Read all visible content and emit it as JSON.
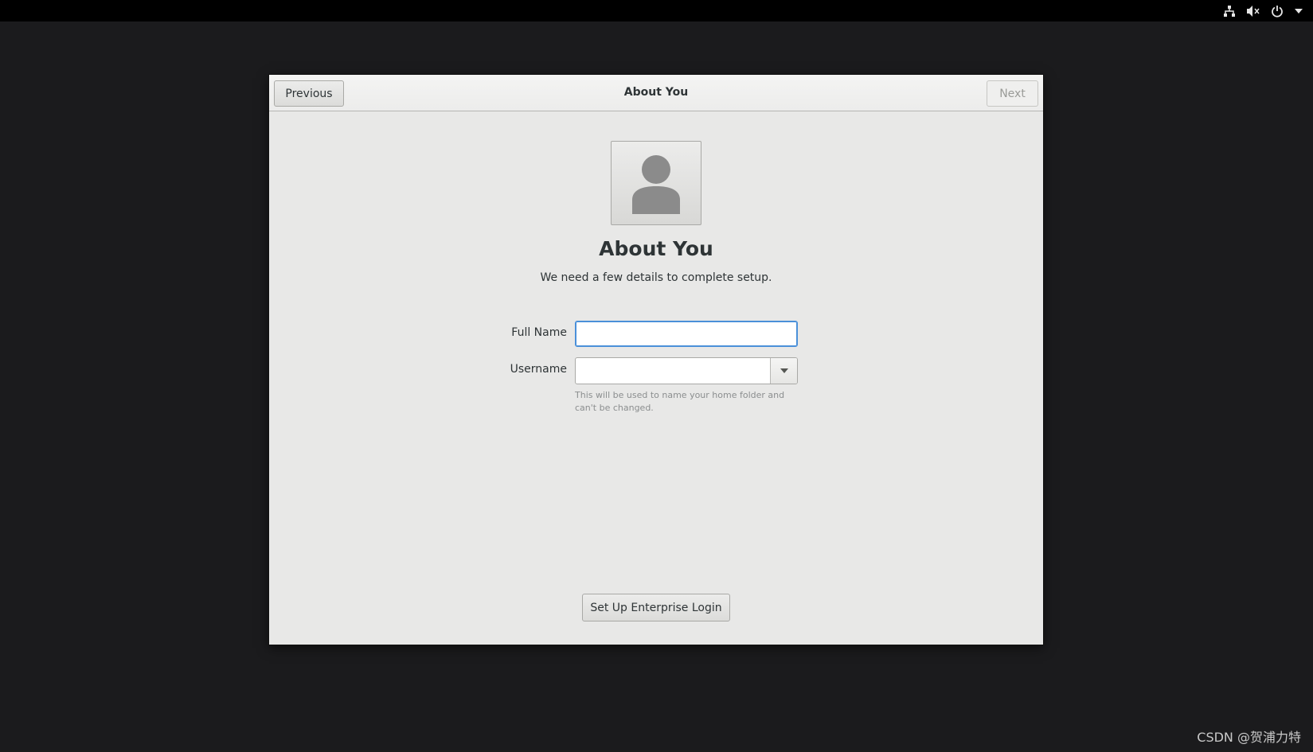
{
  "topbar": {
    "icons": [
      "network-icon",
      "volume-muted-icon",
      "power-icon",
      "menu-arrow-icon"
    ]
  },
  "headerbar": {
    "title": "About You",
    "previous_label": "Previous",
    "next_label": "Next"
  },
  "avatar": {
    "icon": "user-avatar-icon"
  },
  "page": {
    "heading": "About You",
    "subtitle": "We need a few details to complete setup."
  },
  "form": {
    "fullname_label": "Full Name",
    "fullname_value": "",
    "username_label": "Username",
    "username_value": "",
    "username_hint": "This will be used to name your home folder and can't be changed."
  },
  "footer": {
    "enterprise_label": "Set Up Enterprise Login"
  },
  "watermark": "CSDN @贺浦力特",
  "colors": {
    "desktop_bg": "#1b1b1d",
    "topbar_bg": "#000000",
    "window_bg": "#e8e8e7",
    "focus_blue": "#4a90d9"
  }
}
